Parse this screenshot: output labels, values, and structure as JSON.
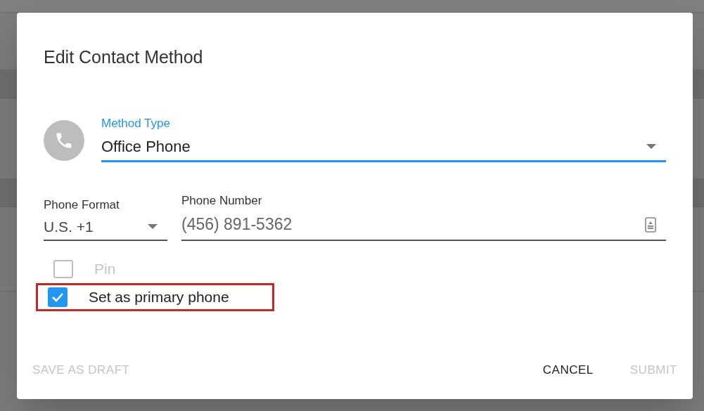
{
  "dialog": {
    "title": "Edit Contact Method",
    "method_type": {
      "label": "Method Type",
      "value": "Office Phone",
      "focused": true
    },
    "phone_format": {
      "label": "Phone Format",
      "value": "U.S. +1"
    },
    "phone_number": {
      "label": "Phone Number",
      "value": "(456) 891-5362"
    },
    "checkboxes": [
      {
        "label": "Pin",
        "checked": false,
        "disabled": true,
        "highlighted": false
      },
      {
        "label": "Set as primary phone",
        "checked": true,
        "disabled": false,
        "highlighted": true
      }
    ],
    "left_buttons": [
      {
        "label": "SAVE AS DRAFT",
        "disabled": true
      }
    ],
    "right_buttons": [
      {
        "label": "CANCEL",
        "disabled": false
      },
      {
        "label": "SUBMIT",
        "disabled": true
      }
    ]
  }
}
